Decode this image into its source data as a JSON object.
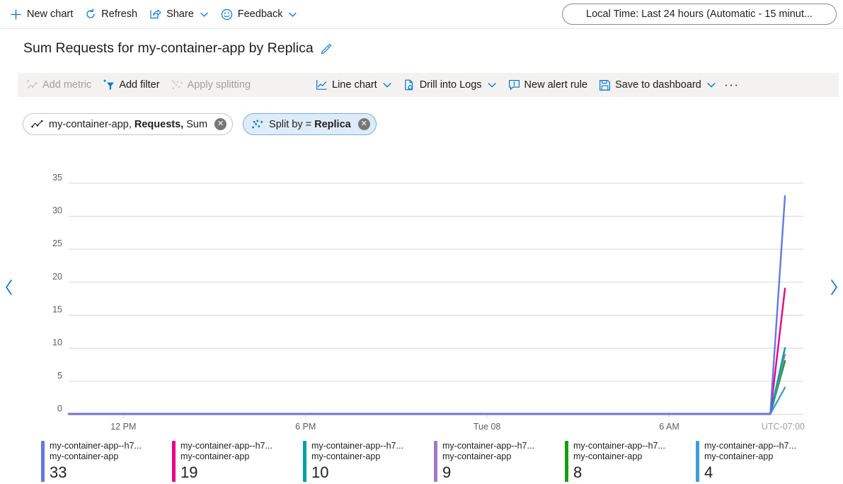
{
  "topbar": {
    "buttons": [
      {
        "label": "New chart",
        "icon": "plus-icon"
      },
      {
        "label": "Refresh",
        "icon": "refresh-icon"
      },
      {
        "label": "Share",
        "icon": "share-icon",
        "has_chevron": true
      },
      {
        "label": "Feedback",
        "icon": "feedback-smiley-icon",
        "has_chevron": true
      }
    ],
    "time_range": "Local Time: Last 24 hours (Automatic - 15 minut..."
  },
  "chart_title": "Sum Requests for my-container-app by Replica",
  "chart_toolbar": {
    "left_buttons": [
      {
        "label": "Add metric",
        "icon": "add-metric-icon",
        "disabled": true
      },
      {
        "label": "Add filter",
        "icon": "add-filter-icon",
        "disabled": false
      },
      {
        "label": "Apply splitting",
        "icon": "apply-splitting-icon",
        "disabled": true
      }
    ],
    "right_buttons": [
      {
        "label": "Line chart",
        "icon": "line-chart-icon",
        "has_chevron": true
      },
      {
        "label": "Drill into Logs",
        "icon": "drill-into-logs-icon",
        "has_chevron": true
      },
      {
        "label": "New alert rule",
        "icon": "new-alert-rule-icon",
        "has_chevron": false
      },
      {
        "label": "Save to dashboard",
        "icon": "save-to-dashboard-icon",
        "has_chevron": true
      }
    ],
    "overflow_label": "···"
  },
  "pills": [
    {
      "icon": "metric-line-icon",
      "prefix": "my-container-app, ",
      "bold": "Requests,",
      "suffix": " Sum",
      "selected": false,
      "close_label": "✕"
    },
    {
      "icon": "splitting-icon",
      "prefix": "Split by = ",
      "bold": "Replica",
      "suffix": "",
      "selected": true,
      "close_label": "✕"
    }
  ],
  "nav": {
    "left_label": "‹",
    "right_label": "›"
  },
  "colors": {
    "accent": "#0078d4",
    "series": [
      "#6279e6",
      "#ec008c",
      "#00a2a2",
      "#9e7bc4",
      "#10a010",
      "#3c9fd8"
    ],
    "grid": "#d6d6d6",
    "toolbar_bg": "#f3f2f1"
  },
  "chart_data": {
    "type": "line",
    "title": "Sum Requests for my-container-app by Replica",
    "xlabel": "",
    "ylabel": "",
    "ylim": [
      0,
      36
    ],
    "yticks": [
      0,
      5,
      10,
      15,
      20,
      25,
      30,
      35
    ],
    "ytick_labels": [
      "0",
      "5",
      "10",
      "15",
      "20",
      "25",
      "30",
      "35"
    ],
    "xtick_labels": [
      "12 PM",
      "6 PM",
      "Tue 08",
      "6 AM"
    ],
    "xtick_positions": [
      0.074,
      0.322,
      0.569,
      0.817
    ],
    "timezone_label": "UTC-07:00",
    "grid": true,
    "legend_position": "bottom",
    "x": [
      0,
      0.955,
      0.975
    ],
    "series": [
      {
        "name": "my-container-app--h7...",
        "sublabel": "my-container-app",
        "color": "#6279e6",
        "peak": 33,
        "values": [
          0,
          0,
          33
        ],
        "legend_value": "33"
      },
      {
        "name": "my-container-app--h7...",
        "sublabel": "my-container-app",
        "color": "#ec008c",
        "peak": 19,
        "values": [
          0,
          0,
          19
        ],
        "legend_value": "19"
      },
      {
        "name": "my-container-app--h7...",
        "sublabel": "my-container-app",
        "color": "#00a2a2",
        "peak": 10,
        "values": [
          0,
          0,
          10
        ],
        "legend_value": "10"
      },
      {
        "name": "my-container-app--h7...",
        "sublabel": "my-container-app",
        "color": "#9e7bc4",
        "peak": 9,
        "values": [
          0,
          0,
          9
        ],
        "legend_value": "9"
      },
      {
        "name": "my-container-app--h7...",
        "sublabel": "my-container-app",
        "color": "#10a010",
        "peak": 8,
        "values": [
          0,
          0,
          8
        ],
        "legend_value": "8"
      },
      {
        "name": "my-container-app--h7...",
        "sublabel": "my-container-app",
        "color": "#3c9fd8",
        "peak": 4,
        "values": [
          0,
          0,
          4
        ],
        "legend_value": "4"
      }
    ]
  }
}
